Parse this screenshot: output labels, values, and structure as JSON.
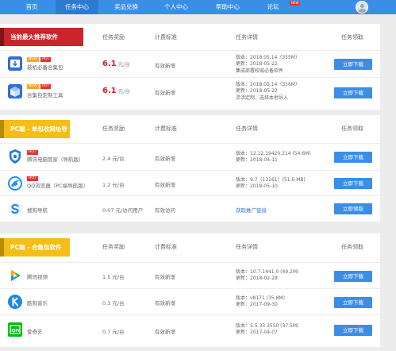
{
  "nav": {
    "items": [
      "首页",
      "任务中心",
      "奖品兑换",
      "个人中心",
      "帮助中心",
      "论坛"
    ],
    "new_badge": "NEW"
  },
  "headers": {
    "reward": "任务奖励",
    "billing": "计费标准",
    "details": "任务详情",
    "claim": "任务领取"
  },
  "sections": [
    {
      "title": "当前最火推荐软件",
      "rows": [
        {
          "tags": [
            "NEW",
            "HOT"
          ],
          "name": "装机必备合集包",
          "reward": "6.1",
          "unit": "元/台",
          "billing": "有效新增",
          "details": [
            "版本：2018.05.14（355M）",
            "更新：2018-05-22",
            "集成部署权威必备软件"
          ],
          "button": "立即下载"
        },
        {
          "tags": [
            "NEW",
            "HOT"
          ],
          "name": "合集包定制工具",
          "reward": "6.1",
          "unit": "元/台",
          "billing": "有效新增",
          "details": [
            "版本：2018.05.14（356M）",
            "更新：2018-05-22",
            "灵活定制，选择本地导入"
          ],
          "button": "立即下载"
        }
      ]
    },
    {
      "title": "PC端 - 单包收网址导航",
      "rows": [
        {
          "tags": [
            "HOT"
          ],
          "name": "腾讯电脑管家（导航版）",
          "reward": "2.4 元/台",
          "billing": "有效新增",
          "details": [
            "版本：12.12.19420.214 (54.6M)",
            "更新：2018-04-11"
          ],
          "button": "立即下载"
        },
        {
          "tags": [
            "HOT"
          ],
          "name": "QQ浏览器（PC端导航版）",
          "reward": "1.2 元/台",
          "billing": "有效新增",
          "details": [
            "版本：9.7（13161）(51.6 MB)",
            "更新：2018-05-10"
          ],
          "button": "立即下载"
        },
        {
          "tags": [],
          "name": "搜狗导航",
          "reward": "0.07 元/访问用户",
          "billing": "有效访问",
          "link": "获取推广链接",
          "button": "立即领取"
        }
      ]
    },
    {
      "title": "PC端 - 合集包软件",
      "rows": [
        {
          "name": "腾讯视频",
          "reward": "1.5 元/台",
          "billing": "有效新增",
          "details": [
            "版本：10.7.1441.0 (49.2M)",
            "更新：2018-02-28"
          ],
          "button": "立即下载"
        },
        {
          "name": "酷狗音乐",
          "reward": "0.3 元/台",
          "billing": "有效新增",
          "details": [
            "版本：v8171 (35.8M)",
            "更新：2017-09-30"
          ],
          "button": "立即下载"
        },
        {
          "name": "爱奇艺",
          "reward": "0.7 元/台",
          "billing": "有效新增",
          "details": [
            "版本：5.5.33.3550 (37.5M)",
            "更新：2017-04-07"
          ],
          "button": "立即下载"
        }
      ]
    }
  ],
  "colors": {
    "nav": "#3a8ee6",
    "button": "#3b8ee8",
    "banner_red": "#c9252b",
    "banner_yellow": "#f6bd17",
    "price_red": "#c9252b"
  },
  "icons": [
    "qq-pc-manager-shield-icon",
    "qq-browser-icon",
    "sogou-s-icon",
    "tencent-video-play-icon",
    "kugou-k-icon",
    "iqiyi-logo-icon",
    "download-box-icon",
    "diy-box-icon",
    "user-avatar-icon"
  ]
}
